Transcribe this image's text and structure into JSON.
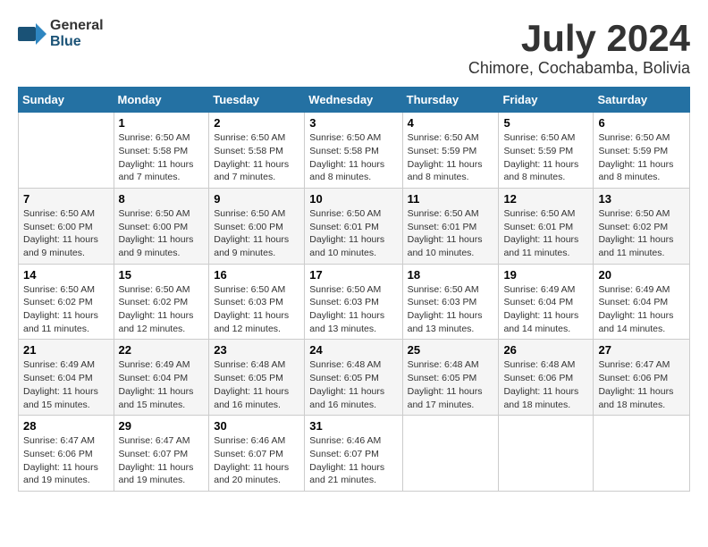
{
  "logo": {
    "general": "General",
    "blue": "Blue"
  },
  "title": "July 2024",
  "subtitle": "Chimore, Cochabamba, Bolivia",
  "headers": [
    "Sunday",
    "Monday",
    "Tuesday",
    "Wednesday",
    "Thursday",
    "Friday",
    "Saturday"
  ],
  "weeks": [
    [
      {
        "day": "",
        "sunrise": "",
        "sunset": "",
        "daylight": ""
      },
      {
        "day": "1",
        "sunrise": "Sunrise: 6:50 AM",
        "sunset": "Sunset: 5:58 PM",
        "daylight": "Daylight: 11 hours and 7 minutes."
      },
      {
        "day": "2",
        "sunrise": "Sunrise: 6:50 AM",
        "sunset": "Sunset: 5:58 PM",
        "daylight": "Daylight: 11 hours and 7 minutes."
      },
      {
        "day": "3",
        "sunrise": "Sunrise: 6:50 AM",
        "sunset": "Sunset: 5:58 PM",
        "daylight": "Daylight: 11 hours and 8 minutes."
      },
      {
        "day": "4",
        "sunrise": "Sunrise: 6:50 AM",
        "sunset": "Sunset: 5:59 PM",
        "daylight": "Daylight: 11 hours and 8 minutes."
      },
      {
        "day": "5",
        "sunrise": "Sunrise: 6:50 AM",
        "sunset": "Sunset: 5:59 PM",
        "daylight": "Daylight: 11 hours and 8 minutes."
      },
      {
        "day": "6",
        "sunrise": "Sunrise: 6:50 AM",
        "sunset": "Sunset: 5:59 PM",
        "daylight": "Daylight: 11 hours and 8 minutes."
      }
    ],
    [
      {
        "day": "7",
        "sunrise": "Sunrise: 6:50 AM",
        "sunset": "Sunset: 6:00 PM",
        "daylight": "Daylight: 11 hours and 9 minutes."
      },
      {
        "day": "8",
        "sunrise": "Sunrise: 6:50 AM",
        "sunset": "Sunset: 6:00 PM",
        "daylight": "Daylight: 11 hours and 9 minutes."
      },
      {
        "day": "9",
        "sunrise": "Sunrise: 6:50 AM",
        "sunset": "Sunset: 6:00 PM",
        "daylight": "Daylight: 11 hours and 9 minutes."
      },
      {
        "day": "10",
        "sunrise": "Sunrise: 6:50 AM",
        "sunset": "Sunset: 6:01 PM",
        "daylight": "Daylight: 11 hours and 10 minutes."
      },
      {
        "day": "11",
        "sunrise": "Sunrise: 6:50 AM",
        "sunset": "Sunset: 6:01 PM",
        "daylight": "Daylight: 11 hours and 10 minutes."
      },
      {
        "day": "12",
        "sunrise": "Sunrise: 6:50 AM",
        "sunset": "Sunset: 6:01 PM",
        "daylight": "Daylight: 11 hours and 11 minutes."
      },
      {
        "day": "13",
        "sunrise": "Sunrise: 6:50 AM",
        "sunset": "Sunset: 6:02 PM",
        "daylight": "Daylight: 11 hours and 11 minutes."
      }
    ],
    [
      {
        "day": "14",
        "sunrise": "Sunrise: 6:50 AM",
        "sunset": "Sunset: 6:02 PM",
        "daylight": "Daylight: 11 hours and 11 minutes."
      },
      {
        "day": "15",
        "sunrise": "Sunrise: 6:50 AM",
        "sunset": "Sunset: 6:02 PM",
        "daylight": "Daylight: 11 hours and 12 minutes."
      },
      {
        "day": "16",
        "sunrise": "Sunrise: 6:50 AM",
        "sunset": "Sunset: 6:03 PM",
        "daylight": "Daylight: 11 hours and 12 minutes."
      },
      {
        "day": "17",
        "sunrise": "Sunrise: 6:50 AM",
        "sunset": "Sunset: 6:03 PM",
        "daylight": "Daylight: 11 hours and 13 minutes."
      },
      {
        "day": "18",
        "sunrise": "Sunrise: 6:50 AM",
        "sunset": "Sunset: 6:03 PM",
        "daylight": "Daylight: 11 hours and 13 minutes."
      },
      {
        "day": "19",
        "sunrise": "Sunrise: 6:49 AM",
        "sunset": "Sunset: 6:04 PM",
        "daylight": "Daylight: 11 hours and 14 minutes."
      },
      {
        "day": "20",
        "sunrise": "Sunrise: 6:49 AM",
        "sunset": "Sunset: 6:04 PM",
        "daylight": "Daylight: 11 hours and 14 minutes."
      }
    ],
    [
      {
        "day": "21",
        "sunrise": "Sunrise: 6:49 AM",
        "sunset": "Sunset: 6:04 PM",
        "daylight": "Daylight: 11 hours and 15 minutes."
      },
      {
        "day": "22",
        "sunrise": "Sunrise: 6:49 AM",
        "sunset": "Sunset: 6:04 PM",
        "daylight": "Daylight: 11 hours and 15 minutes."
      },
      {
        "day": "23",
        "sunrise": "Sunrise: 6:48 AM",
        "sunset": "Sunset: 6:05 PM",
        "daylight": "Daylight: 11 hours and 16 minutes."
      },
      {
        "day": "24",
        "sunrise": "Sunrise: 6:48 AM",
        "sunset": "Sunset: 6:05 PM",
        "daylight": "Daylight: 11 hours and 16 minutes."
      },
      {
        "day": "25",
        "sunrise": "Sunrise: 6:48 AM",
        "sunset": "Sunset: 6:05 PM",
        "daylight": "Daylight: 11 hours and 17 minutes."
      },
      {
        "day": "26",
        "sunrise": "Sunrise: 6:48 AM",
        "sunset": "Sunset: 6:06 PM",
        "daylight": "Daylight: 11 hours and 18 minutes."
      },
      {
        "day": "27",
        "sunrise": "Sunrise: 6:47 AM",
        "sunset": "Sunset: 6:06 PM",
        "daylight": "Daylight: 11 hours and 18 minutes."
      }
    ],
    [
      {
        "day": "28",
        "sunrise": "Sunrise: 6:47 AM",
        "sunset": "Sunset: 6:06 PM",
        "daylight": "Daylight: 11 hours and 19 minutes."
      },
      {
        "day": "29",
        "sunrise": "Sunrise: 6:47 AM",
        "sunset": "Sunset: 6:07 PM",
        "daylight": "Daylight: 11 hours and 19 minutes."
      },
      {
        "day": "30",
        "sunrise": "Sunrise: 6:46 AM",
        "sunset": "Sunset: 6:07 PM",
        "daylight": "Daylight: 11 hours and 20 minutes."
      },
      {
        "day": "31",
        "sunrise": "Sunrise: 6:46 AM",
        "sunset": "Sunset: 6:07 PM",
        "daylight": "Daylight: 11 hours and 21 minutes."
      },
      {
        "day": "",
        "sunrise": "",
        "sunset": "",
        "daylight": ""
      },
      {
        "day": "",
        "sunrise": "",
        "sunset": "",
        "daylight": ""
      },
      {
        "day": "",
        "sunrise": "",
        "sunset": "",
        "daylight": ""
      }
    ]
  ]
}
